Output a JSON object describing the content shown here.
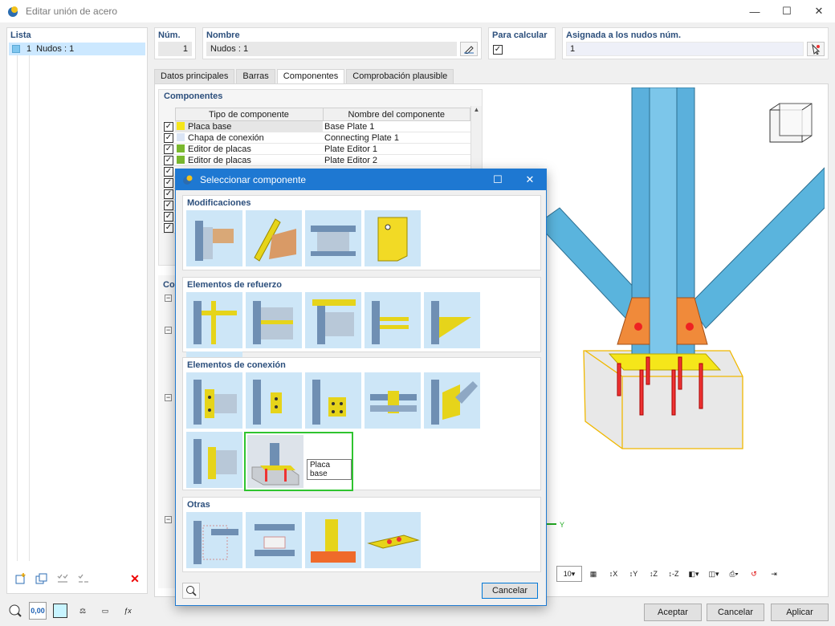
{
  "window": {
    "title": "Editar unión de acero",
    "minimize": "—",
    "maximize": "☐",
    "close": "✕"
  },
  "left": {
    "header": "Lista",
    "item_num": "1",
    "item_label": "Nudos : 1"
  },
  "num": {
    "label": "Núm.",
    "value": "1"
  },
  "nombre": {
    "label": "Nombre",
    "value": "Nudos : 1"
  },
  "para_calcular": {
    "label": "Para calcular",
    "checked": "✓"
  },
  "asignada": {
    "label": "Asignada a los nudos núm.",
    "value": "1"
  },
  "tabs": [
    "Datos principales",
    "Barras",
    "Componentes",
    "Comprobación plausible"
  ],
  "componentes": {
    "title": "Componentes",
    "col_tipo": "Tipo de componente",
    "col_nombre": "Nombre del componente",
    "rows": [
      {
        "tipo": "Placa base",
        "nombre": "Base Plate 1",
        "color": "#f5e61a"
      },
      {
        "tipo": "Chapa de conexión",
        "nombre": "Connecting Plate 1",
        "color": "#dbe5f5"
      },
      {
        "tipo": "Editor de placas",
        "nombre": "Plate Editor 1",
        "color": "#7ab82e"
      },
      {
        "tipo": "Editor de placas",
        "nombre": "Plate Editor 2",
        "color": "#7ab82e"
      }
    ],
    "lower_label": "Co"
  },
  "dialog": {
    "title": "Seleccionar componente",
    "sections": {
      "modificaciones": "Modificaciones",
      "refuerzo": "Elementos de refuerzo",
      "conexion": "Elementos de conexión",
      "otras": "Otras"
    },
    "tooltip": "Placa base",
    "cancel": "Cancelar"
  },
  "viewport": {
    "axis_y": "Y",
    "zoom_value": "10"
  },
  "buttons": {
    "aceptar": "Aceptar",
    "cancelar": "Cancelar",
    "aplicar": "Aplicar"
  },
  "bottom_value": "0,00"
}
